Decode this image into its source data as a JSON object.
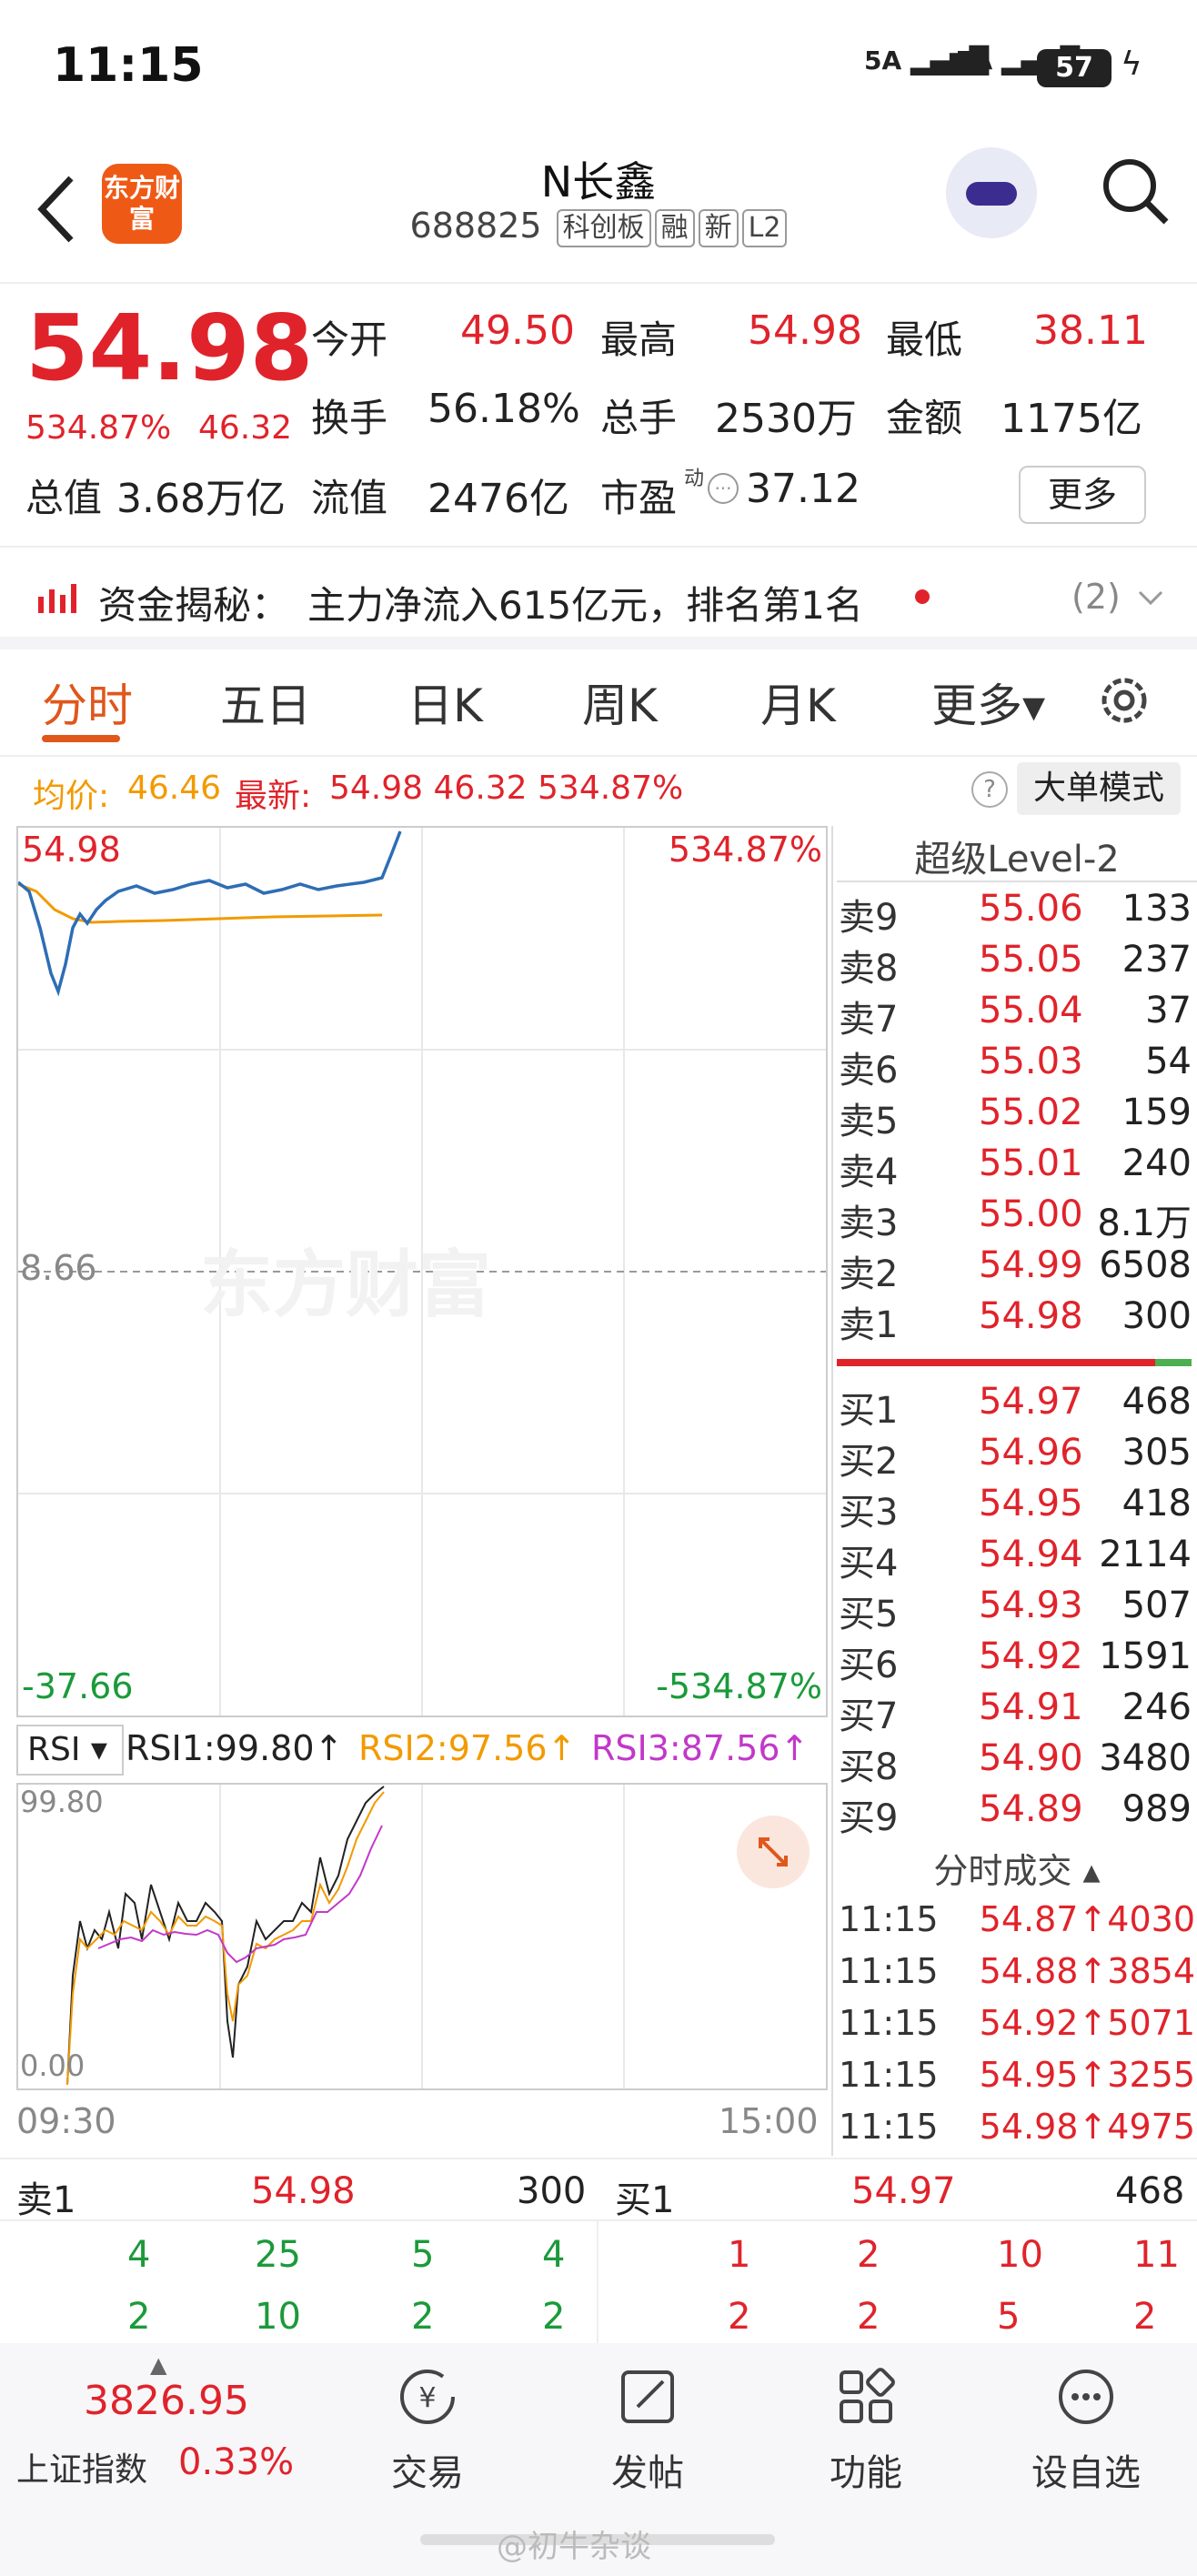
{
  "status_bar": {
    "time": "11:15",
    "signal1": "5A",
    "signal2": "5A",
    "battery": "57"
  },
  "header": {
    "logo_text": "东方财富",
    "stock_name": "N长鑫",
    "code": "688825",
    "tags": [
      "科创板",
      "融",
      "新",
      "L2"
    ]
  },
  "quote": {
    "price": "54.98",
    "change_pct": "534.87%",
    "change": "46.32",
    "open_label": "今开",
    "open": "49.50",
    "high_label": "最高",
    "high": "54.98",
    "low_label": "最低",
    "low": "38.11",
    "turnover_label": "换手",
    "turnover": "56.18%",
    "vol_label": "总手",
    "vol": "2530万",
    "amount_label": "金额",
    "amount": "1175亿",
    "mcap_label": "总值",
    "mcap": "3.68万亿",
    "float_label": "流值",
    "float": "2476亿",
    "pe_label": "市盈",
    "pe_sup": "动",
    "pe": "37.12",
    "more": "更多"
  },
  "fund": {
    "label": "资金揭秘：",
    "text": "主力净流入615亿元，排名第1名",
    "count": "(2)"
  },
  "tabs": [
    "分时",
    "五日",
    "日K",
    "周K",
    "月K",
    "更多▾"
  ],
  "chart_info": {
    "avg_label": "均价:",
    "avg": "46.46",
    "latest_label": "最新:",
    "latest": "54.98 46.32 534.87%",
    "mode": "大单模式",
    "help": "?"
  },
  "chart": {
    "top_left": "54.98",
    "top_right": "534.87%",
    "mid": "8.66",
    "bot_left": "-37.66",
    "bot_right": "-534.87%",
    "watermark": "东方财富"
  },
  "rsi": {
    "label": "RSI ▾",
    "rsi1": "RSI1:99.80↑",
    "rsi2": "RSI2:97.56↑",
    "rsi3": "RSI3:87.56↑",
    "top": "99.80",
    "bottom": "0.00",
    "t_start": "09:30",
    "t_end": "15:00"
  },
  "orderbook": {
    "title": "超级Level-2",
    "asks": [
      [
        "卖9",
        "55.06",
        "133"
      ],
      [
        "卖8",
        "55.05",
        "237"
      ],
      [
        "卖7",
        "55.04",
        "37"
      ],
      [
        "卖6",
        "55.03",
        "54"
      ],
      [
        "卖5",
        "55.02",
        "159"
      ],
      [
        "卖4",
        "55.01",
        "240"
      ],
      [
        "卖3",
        "55.00",
        "8.1万"
      ],
      [
        "卖2",
        "54.99",
        "6508"
      ],
      [
        "卖1",
        "54.98",
        "300"
      ]
    ],
    "bids": [
      [
        "买1",
        "54.97",
        "468"
      ],
      [
        "买2",
        "54.96",
        "305"
      ],
      [
        "买3",
        "54.95",
        "418"
      ],
      [
        "买4",
        "54.94",
        "2114"
      ],
      [
        "买5",
        "54.93",
        "507"
      ],
      [
        "买6",
        "54.92",
        "1591"
      ],
      [
        "买7",
        "54.91",
        "246"
      ],
      [
        "买8",
        "54.90",
        "3480"
      ],
      [
        "买9",
        "54.89",
        "989"
      ]
    ]
  },
  "trades": {
    "title": "分时成交 ▴",
    "rows": [
      [
        "11:15",
        "54.87↑4030"
      ],
      [
        "11:15",
        "54.88↑3854"
      ],
      [
        "11:15",
        "54.92↑5071"
      ],
      [
        "11:15",
        "54.95↑3255"
      ],
      [
        "11:15",
        "54.98↑4975"
      ]
    ]
  },
  "queue": {
    "sell_label": "卖1",
    "sell_price": "54.98",
    "sell_vol": "300",
    "buy_label": "买1",
    "buy_price": "54.97",
    "buy_vol": "468",
    "sell_q1": [
      "4",
      "25",
      "5",
      "4"
    ],
    "sell_q2": [
      "2",
      "10",
      "2",
      "2"
    ],
    "buy_q1": [
      "1",
      "2",
      "10",
      "11"
    ],
    "buy_q2": [
      "2",
      "2",
      "5",
      "2"
    ]
  },
  "index": {
    "value": "3826.95",
    "name": "上证指数",
    "pct": "0.33%"
  },
  "nav": [
    "交易",
    "发帖",
    "功能",
    "设自选"
  ],
  "watermark": "@初牛杂谈",
  "colors": {
    "red": "#e0232b",
    "green": "#1b9a3a",
    "orange": "#f29a00",
    "accent": "#e0571b"
  }
}
